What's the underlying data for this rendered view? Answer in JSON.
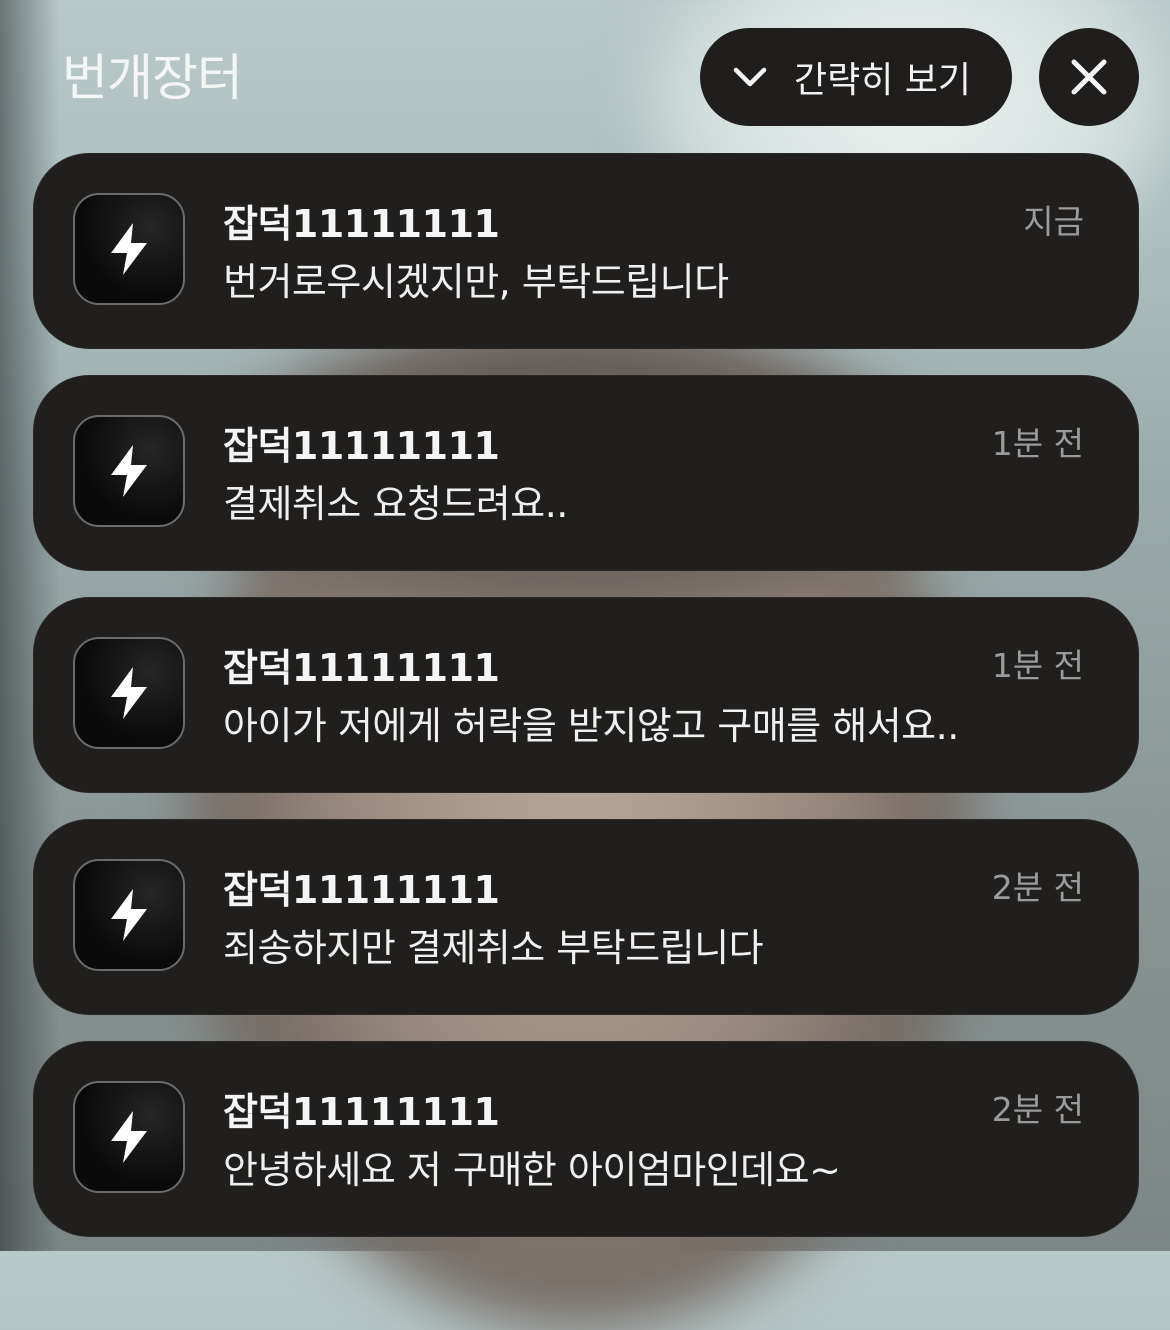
{
  "header": {
    "app_title": "번개장터",
    "collapse_label": "간략히 보기"
  },
  "notifications": [
    {
      "sender": "잡덕11111111",
      "message": "번거로우시겠지만, 부탁드립니다",
      "time": "지금"
    },
    {
      "sender": "잡덕11111111",
      "message": "결제취소 요청드려요..",
      "time": "1분 전"
    },
    {
      "sender": "잡덕11111111",
      "message": "아이가 저에게 허락을 받지않고 구매를 해서요..",
      "time": "1분 전"
    },
    {
      "sender": "잡덕11111111",
      "message": "죄송하지만 결제취소 부탁드립니다",
      "time": "2분 전"
    },
    {
      "sender": "잡덕11111111",
      "message": "안녕하세요 저 구매한 아이엄마인데요~",
      "time": "2분 전"
    }
  ],
  "icons": {
    "app_icon": "lightning-bolt-icon",
    "collapse": "chevron-down-icon",
    "close": "close-icon"
  }
}
